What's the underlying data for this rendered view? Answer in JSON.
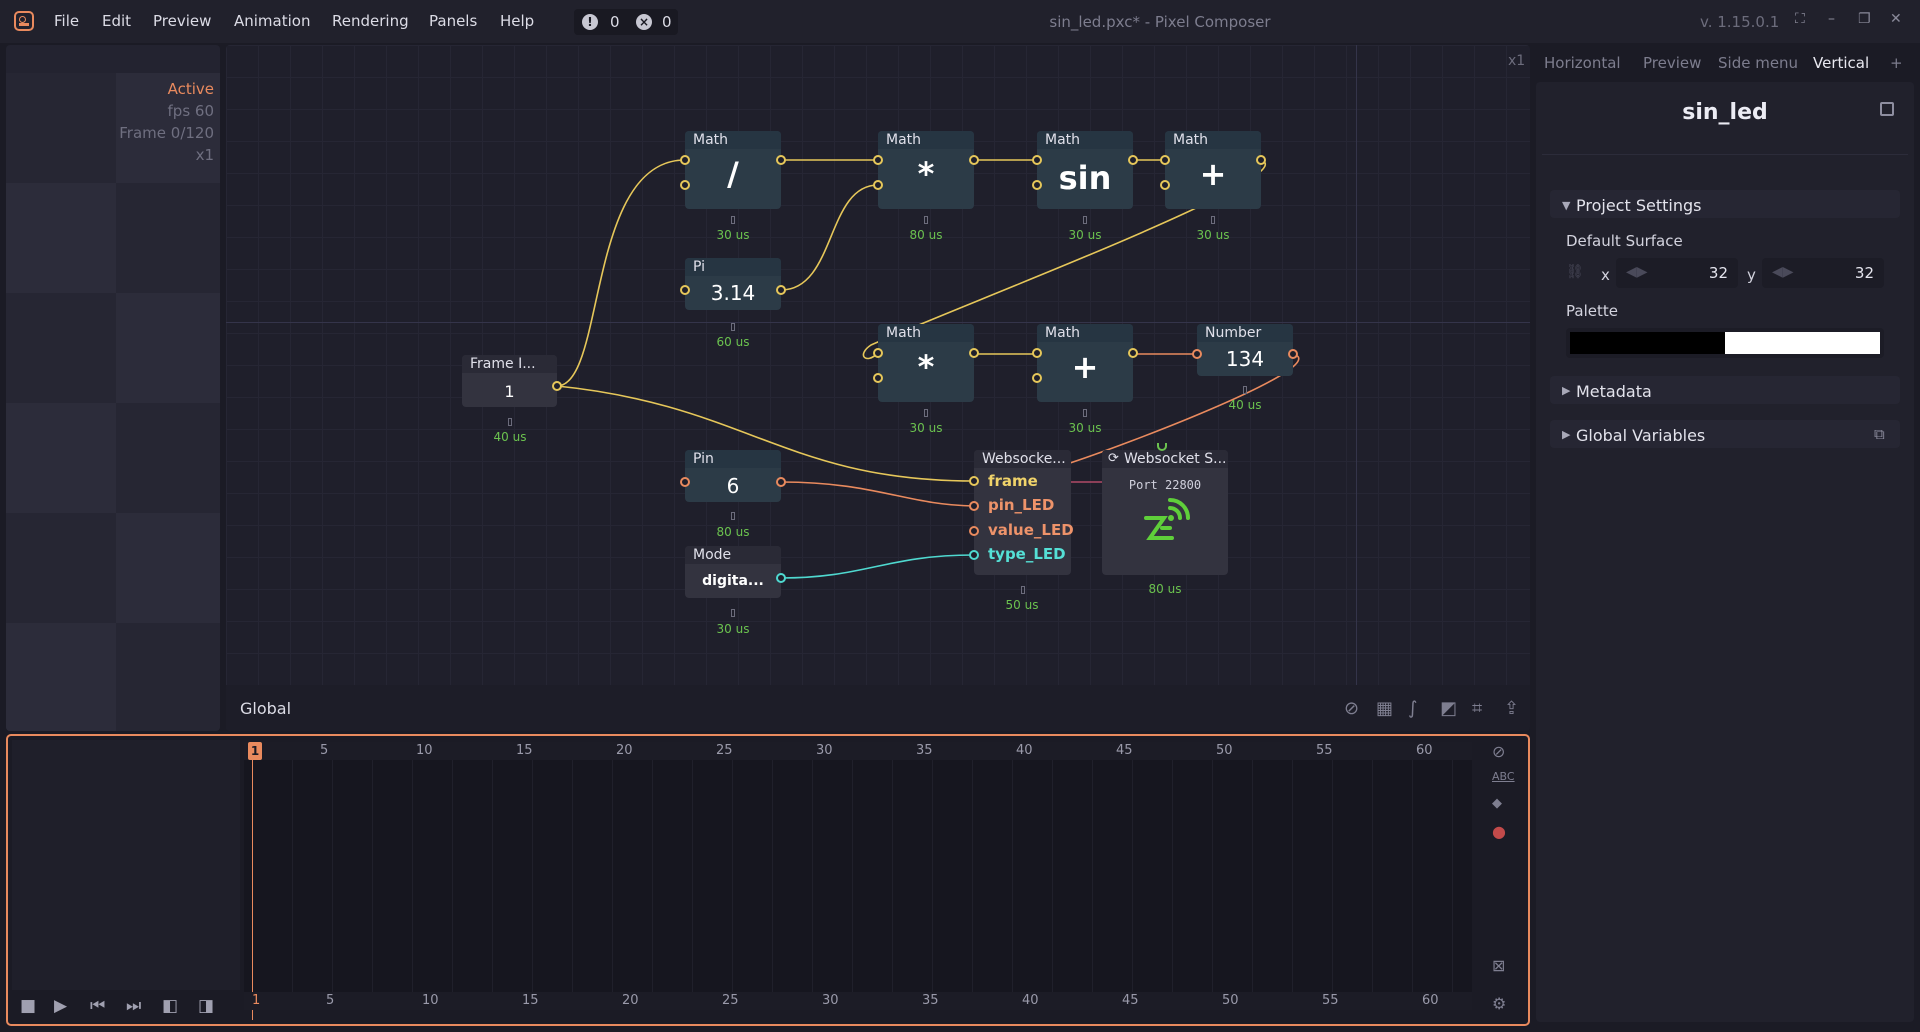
{
  "topbar": {
    "menu": [
      "File",
      "Edit",
      "Preview",
      "Animation",
      "Rendering",
      "Panels",
      "Help"
    ],
    "warnings": "0",
    "errors": "0",
    "window_title": "sin_led.pxc* - Pixel Composer",
    "version": "v. 1.15.0.1"
  },
  "preview": {
    "status": "Active",
    "fps": "fps 60",
    "frame": "Frame 0/120",
    "zoom": "x1"
  },
  "graph": {
    "zoom": "x1",
    "context_label": "Global",
    "nodes": {
      "math1": {
        "title": "Math",
        "value": "/",
        "time": "30 us"
      },
      "math2": {
        "title": "Math",
        "value": "*",
        "time": "80 us"
      },
      "math3": {
        "title": "Math",
        "value": "sin",
        "time": "30 us"
      },
      "math4": {
        "title": "Math",
        "value": "+",
        "time": "30 us"
      },
      "pi": {
        "title": "Pi",
        "value": "3.14",
        "time": "60 us"
      },
      "frame_index": {
        "title": "Frame I...",
        "value": "1",
        "time": "40 us"
      },
      "math5": {
        "title": "Math",
        "value": "*",
        "time": "30 us"
      },
      "math6": {
        "title": "Math",
        "value": "+",
        "time": "30 us"
      },
      "number": {
        "title": "Number",
        "value": "134",
        "time": "40 us"
      },
      "pin": {
        "title": "Pin",
        "value": "6",
        "time": "80 us"
      },
      "mode": {
        "title": "Mode",
        "value": "digita...",
        "time": "30 us"
      },
      "ws_send": {
        "title": "Websocke...",
        "time": "50 us",
        "ports": [
          "frame",
          "pin_LED",
          "value_LED",
          "type_LED"
        ]
      },
      "ws_server": {
        "title": "Websocket S...",
        "port_text": "Port 22800",
        "time": "80 us"
      }
    }
  },
  "inspector": {
    "tabs": [
      "Horizontal",
      "Preview",
      "Side menu",
      "Vertical",
      "+"
    ],
    "title": "sin_led",
    "project_settings": "Project Settings",
    "default_surface": "Default Surface",
    "x_label": "x",
    "x_value": "32",
    "y_label": "y",
    "y_value": "32",
    "palette_label": "Palette",
    "palette_colors": [
      "#000000",
      "#ffffff"
    ],
    "metadata": "Metadata",
    "global_variables": "Global Variables"
  },
  "timeline": {
    "current_frame": "1",
    "ruler_top": [
      "5",
      "10",
      "15",
      "20",
      "25",
      "30",
      "35",
      "40",
      "45",
      "50",
      "55",
      "60"
    ],
    "ruler_bottom": [
      "1",
      "5",
      "10",
      "15",
      "20",
      "25",
      "30",
      "35",
      "40",
      "45",
      "50",
      "55",
      "60"
    ],
    "side_label": "ABC"
  },
  "colors": {
    "accent": "#e98a5e",
    "wire_number": "#e6c75a",
    "wire_integer": "#e98a5e",
    "wire_enum": "#4fd9d0",
    "time_text": "#6bc24f"
  }
}
